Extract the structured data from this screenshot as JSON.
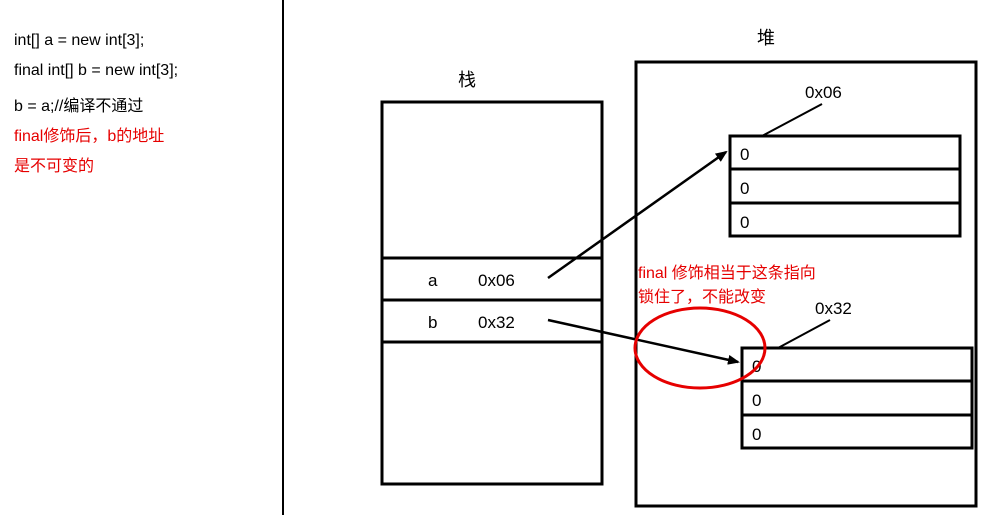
{
  "code": {
    "l1": "int[] a = new int[3];",
    "l2": "final int[] b = new int[3];",
    "l3": "b = a;//编译不通过",
    "note1": "final修饰后，b的地址",
    "note2": "是不可变的"
  },
  "labels": {
    "stack": "栈",
    "heap": "堆",
    "addr_a": "0x06",
    "addr_b": "0x32",
    "var_a": "a",
    "var_b": "b",
    "stack_a_val": "0x06",
    "stack_b_val": "0x32",
    "zero": "0",
    "arrow_note1": "final 修饰相当于这条指向",
    "arrow_note2": "锁住了，不能改变"
  },
  "diagram": {
    "arrays": [
      {
        "address": "0x06",
        "cells": [
          "0",
          "0",
          "0"
        ]
      },
      {
        "address": "0x32",
        "cells": [
          "0",
          "0",
          "0"
        ]
      }
    ],
    "stack_slots": [
      {
        "name": "a",
        "value": "0x06"
      },
      {
        "name": "b",
        "value": "0x32"
      }
    ]
  }
}
